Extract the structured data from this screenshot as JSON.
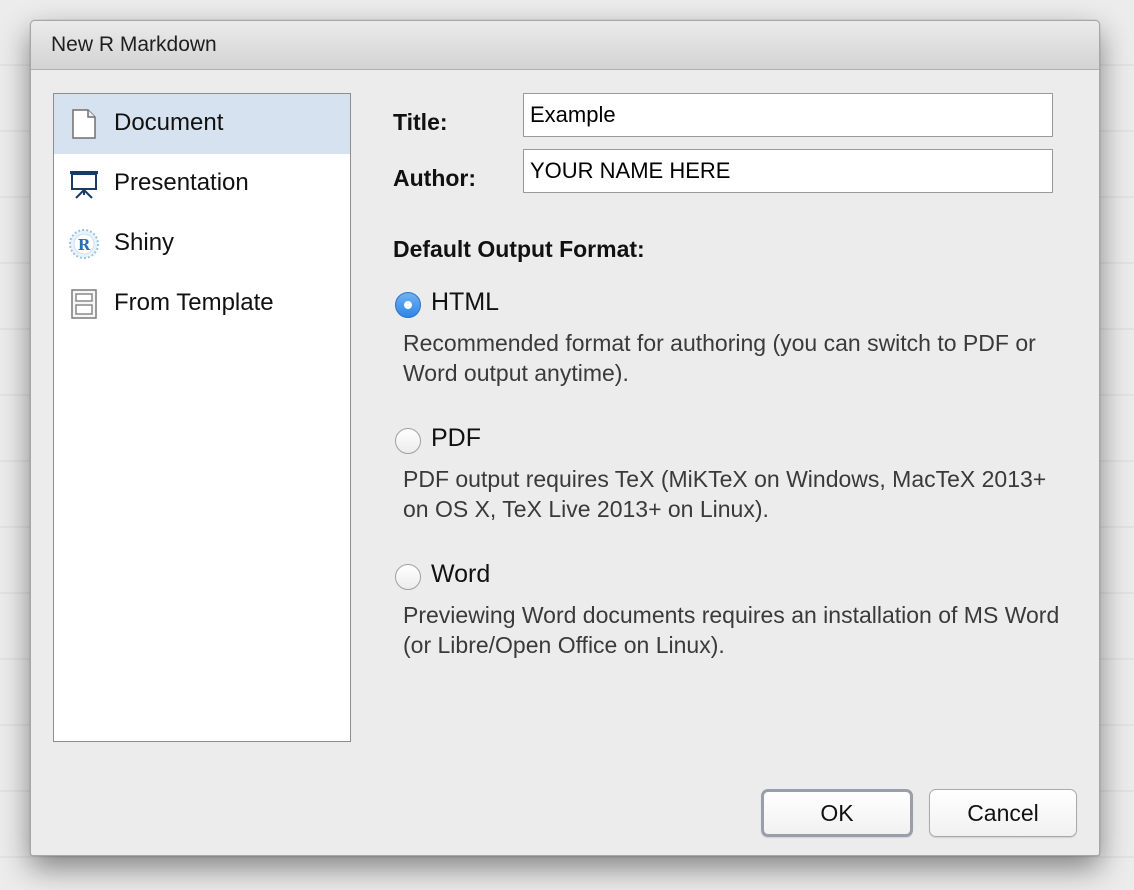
{
  "window": {
    "title": "New R Markdown"
  },
  "sidebar": {
    "items": [
      {
        "label": "Document",
        "icon": "document-icon",
        "selected": true
      },
      {
        "label": "Presentation",
        "icon": "presentation-icon",
        "selected": false
      },
      {
        "label": "Shiny",
        "icon": "shiny-icon",
        "selected": false
      },
      {
        "label": "From Template",
        "icon": "template-icon",
        "selected": false
      }
    ]
  },
  "form": {
    "title_label": "Title:",
    "title_value": "Example",
    "author_label": "Author:",
    "author_value": "YOUR NAME HERE"
  },
  "output": {
    "heading": "Default Output Format:",
    "options": [
      {
        "label": "HTML",
        "selected": true,
        "description": "Recommended format for authoring (you can switch to PDF or Word output anytime)."
      },
      {
        "label": "PDF",
        "selected": false,
        "description": "PDF output requires TeX (MiKTeX on Windows, MacTeX 2013+ on OS X, TeX Live 2013+ on Linux)."
      },
      {
        "label": "Word",
        "selected": false,
        "description": "Previewing Word documents requires an installation of MS Word (or Libre/Open Office on Linux)."
      }
    ]
  },
  "buttons": {
    "ok": "OK",
    "cancel": "Cancel"
  },
  "colors": {
    "selection": "#d6e2ef",
    "radio_accent": "#2e86e6"
  }
}
